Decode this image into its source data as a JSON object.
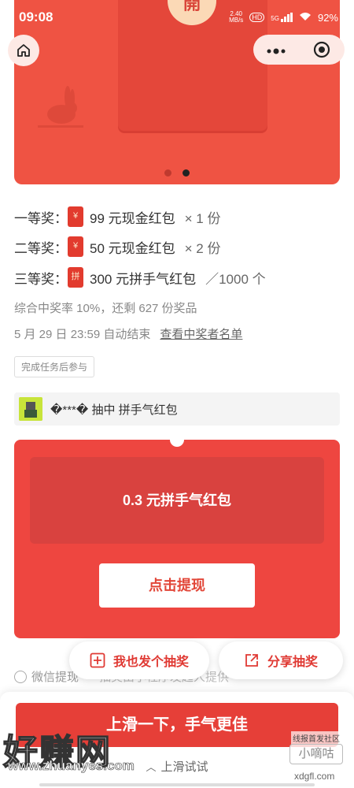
{
  "status_bar": {
    "time": "09:08",
    "network_speed_top": "2.40",
    "network_speed_bottom": "MB/s",
    "hd_label": "HD",
    "signal_label": "5G",
    "battery": "92%"
  },
  "banner": {
    "open_label": "開",
    "active_slide": 2,
    "slide_count": 2
  },
  "prizes": [
    {
      "level": "一等奖：",
      "icon_char": "¥",
      "desc": "99 元现金红包",
      "qty": "× 1 份"
    },
    {
      "level": "二等奖：",
      "icon_char": "¥",
      "desc": "50 元现金红包",
      "qty": "× 2 份"
    },
    {
      "level": "三等奖：",
      "icon_char": "拼",
      "desc": "300 元拼手气红包",
      "qty": "／1000 个"
    }
  ],
  "stats": "综合中奖率 10%，还剩 627 份奖品",
  "end_info": {
    "text": "5 月 29 日 23:59 自动结束",
    "link": "查看中奖者名单"
  },
  "condition_tag": "完成任务后参与",
  "winner": {
    "text": "�***� 抽中 拼手气红包"
  },
  "prize_card": {
    "title": "0.3 元拼手气红包",
    "withdraw_label": "点击提现"
  },
  "check_row": {
    "label": "微信提现",
    "ghost": "抽奖由小程序发起人提供"
  },
  "float_buttons": {
    "create": "我也发个抽奖",
    "share": "分享抽奖"
  },
  "bottom_sheet": {
    "cta": "上滑一下，手气更佳",
    "hint": "上滑试试"
  },
  "watermark": {
    "big": "好赚网",
    "url": "www.zhuanyes.com",
    "right_1": "线报首发社区",
    "right_2": "小嘀咕",
    "right_3": "xdgfl.com"
  },
  "colors": {
    "brand_red": "#ef5343",
    "button_red": "#e63f38"
  }
}
